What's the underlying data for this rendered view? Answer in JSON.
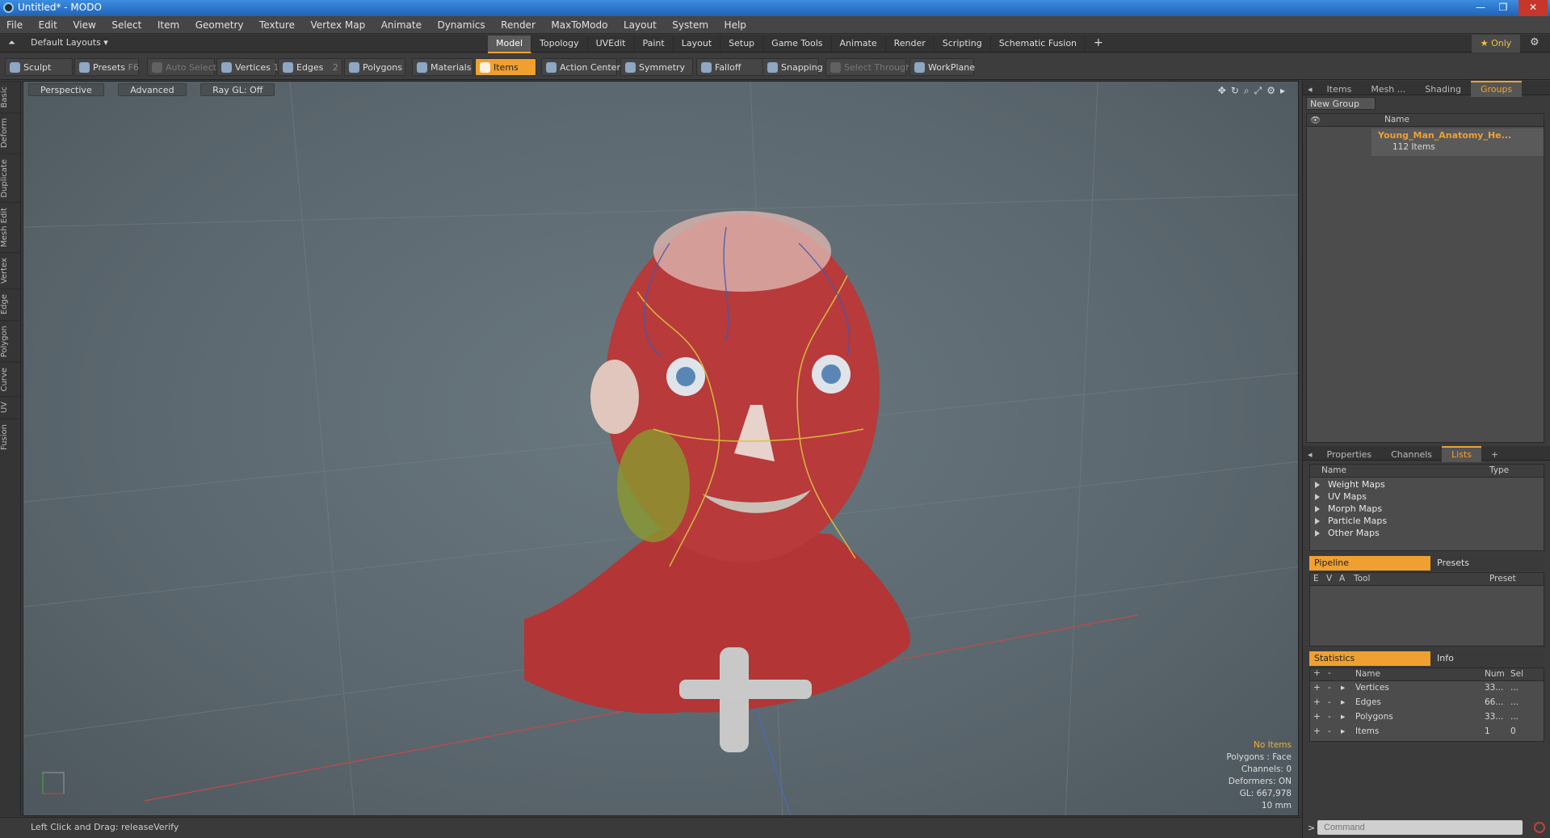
{
  "window": {
    "title": "Untitled* - MODO"
  },
  "menu": [
    "File",
    "Edit",
    "View",
    "Select",
    "Item",
    "Geometry",
    "Texture",
    "Vertex Map",
    "Animate",
    "Dynamics",
    "Render",
    "MaxToModo",
    "Layout",
    "System",
    "Help"
  ],
  "layout": {
    "preset": "Default Layouts ▾",
    "tabs": [
      "Model",
      "Topology",
      "UVEdit",
      "Paint",
      "Layout",
      "Setup",
      "Game Tools",
      "Animate",
      "Render",
      "Scripting",
      "Schematic Fusion"
    ],
    "add": "+",
    "only": "★ Only"
  },
  "toolbar": {
    "sculpt": "Sculpt",
    "presets": "Presets",
    "presets_key": "F6",
    "auto_select": "Auto Select",
    "vertices": "Vertices",
    "vertices_count": "1",
    "edges": "Edges",
    "edges_count": "2",
    "polygons": "Polygons",
    "materials": "Materials",
    "items": "Items",
    "action_center": "Action Center",
    "symmetry": "Symmetry",
    "falloff": "Falloff",
    "snapping": "Snapping",
    "select_through": "Select Through",
    "workplane": "WorkPlane"
  },
  "left_tabs": [
    "Basic",
    "Deform",
    "Duplicate",
    "Mesh Edit",
    "Vertex",
    "Edge",
    "Polygon",
    "Curve",
    "UV",
    "Fusion"
  ],
  "viewport": {
    "view": "Perspective",
    "mode": "Advanced",
    "raygl": "Ray GL: Off",
    "stats": {
      "selection": "No Items",
      "polygons": "Polygons : Face",
      "channels": "Channels: 0",
      "deformers": "Deformers: ON",
      "gl": "GL: 667,978",
      "unit": "10 mm"
    }
  },
  "status": {
    "hint": "Left Click and Drag:  releaseVerify"
  },
  "groups_panel": {
    "tabs": [
      "Items",
      "Mesh ...",
      "Shading",
      "Groups"
    ],
    "new_group": "New Group",
    "col_name": "Name",
    "group_name": "Young_Man_Anatomy_He...",
    "group_count": "112 Items"
  },
  "lists_panel": {
    "tabs": [
      "Properties",
      "Channels",
      "Lists",
      "+"
    ],
    "col_name": "Name",
    "col_type": "Type",
    "items": [
      "Weight Maps",
      "UV Maps",
      "Morph Maps",
      "Particle Maps",
      "Other Maps"
    ]
  },
  "pipeline_panel": {
    "tab_active": "Pipeline",
    "tab_other": "Presets",
    "cols": [
      "E",
      "V",
      "A",
      "Tool",
      "Preset"
    ]
  },
  "stats_panel": {
    "tab_active": "Statistics",
    "tab_other": "Info",
    "col_name": "Name",
    "col_num": "Num",
    "col_sel": "Sel",
    "rows": [
      {
        "name": "Vertices",
        "num": "33...",
        "sel": "..."
      },
      {
        "name": "Edges",
        "num": "66...",
        "sel": "..."
      },
      {
        "name": "Polygons",
        "num": "33...",
        "sel": "..."
      },
      {
        "name": "Items",
        "num": "1",
        "sel": "0"
      }
    ]
  },
  "command": {
    "placeholder": "Command"
  },
  "colors": {
    "accent": "#f0a030",
    "viewport_bg": "#5b676e",
    "skin_muscle": "#b83a3a"
  }
}
